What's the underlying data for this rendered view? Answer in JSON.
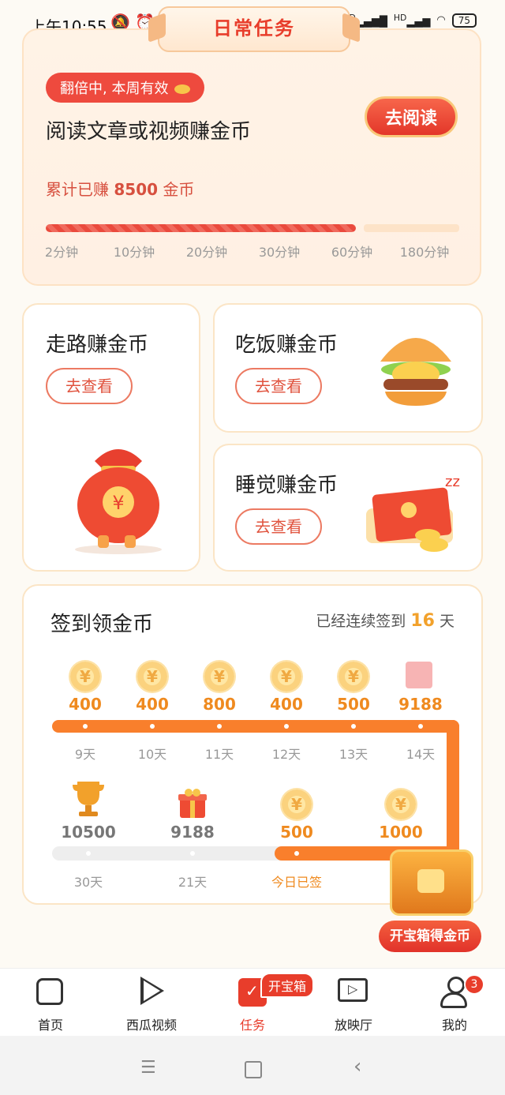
{
  "status_bar": {
    "time": "上午10:55",
    "battery": "75",
    "network_a": "HD",
    "network_b": "HD"
  },
  "header": {
    "title": "日常任务"
  },
  "reading": {
    "badge": "翻倍中, 本周有效",
    "title": "阅读文章或视频赚金币",
    "button": "去阅读",
    "earned_prefix": "累计已赚",
    "earned_value": "8500",
    "earned_suffix": "金币",
    "progress_fraction": 0.75,
    "ticks": [
      "2分钟",
      "10分钟",
      "20分钟",
      "30分钟",
      "60分钟",
      "180分钟"
    ]
  },
  "tasks": {
    "walk": {
      "title": "走路赚金币",
      "button": "去查看"
    },
    "eat": {
      "title": "吃饭赚金币",
      "button": "去查看"
    },
    "sleep": {
      "title": "睡觉赚金币",
      "button": "去查看"
    }
  },
  "signin": {
    "title": "签到领金币",
    "streak_prefix": "已经连续签到",
    "streak_days": "16",
    "streak_suffix": "天",
    "row1": [
      {
        "amount": "400",
        "day": "9天",
        "icon": "coin"
      },
      {
        "amount": "400",
        "day": "10天",
        "icon": "coin"
      },
      {
        "amount": "800",
        "day": "11天",
        "icon": "coin"
      },
      {
        "amount": "400",
        "day": "12天",
        "icon": "coin"
      },
      {
        "amount": "500",
        "day": "13天",
        "icon": "coin"
      },
      {
        "amount": "9188",
        "day": "14天",
        "icon": "gift"
      }
    ],
    "row2": [
      {
        "amount": "10500",
        "day": "30天",
        "icon": "trophy"
      },
      {
        "amount": "9188",
        "day": "21天",
        "icon": "gift"
      },
      {
        "amount": "500",
        "day": "今日已签",
        "icon": "coin"
      },
      {
        "amount": "1000",
        "day": "",
        "icon": "coin"
      }
    ],
    "chest_button": "开宝箱得金币"
  },
  "nav": {
    "items": [
      {
        "label": "首页",
        "icon": "home-icon"
      },
      {
        "label": "西瓜视频",
        "icon": "play-icon"
      },
      {
        "label": "任务",
        "icon": "task-icon"
      },
      {
        "label": "放映厅",
        "icon": "tv-icon"
      },
      {
        "label": "我的",
        "icon": "user-icon"
      }
    ],
    "chest_badge": "开宝箱",
    "profile_badge": "3"
  },
  "colors": {
    "accent": "#e83d2b",
    "orange": "#f97f2c",
    "gold": "#ef8a1f"
  }
}
